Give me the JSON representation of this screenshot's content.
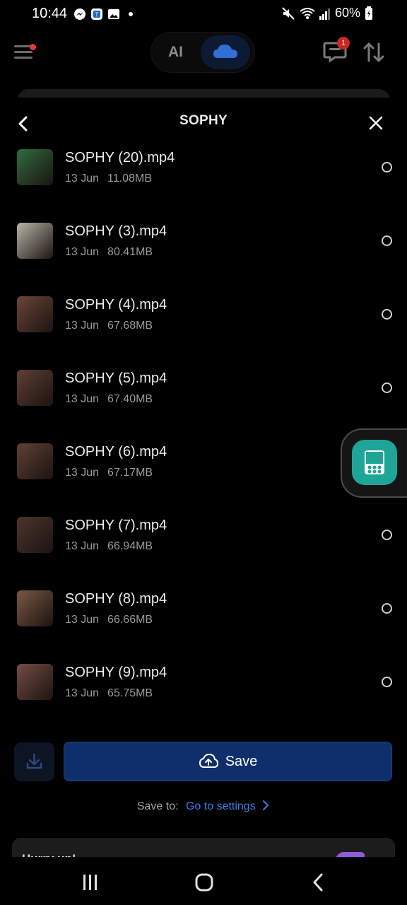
{
  "status_bar": {
    "time": "10:44",
    "battery": "60%",
    "app_icons": [
      "messenger-icon",
      "teams-icon",
      "gallery-icon",
      "dot-icon"
    ],
    "right_icons": [
      "mute-icon",
      "wifi-icon",
      "signal-icon",
      "battery-icon"
    ]
  },
  "app_bar": {
    "toggle_ai_label": "AI",
    "message_badge": "1"
  },
  "sheet": {
    "title": "SOPHY",
    "files": [
      {
        "name": "SOPHY (20).mp4",
        "date": "13 Jun",
        "size": "11.08MB",
        "thumb": "#2f6b3e"
      },
      {
        "name": "SOPHY (3).mp4",
        "date": "13 Jun",
        "size": "80.41MB",
        "thumb": "#b7b4a8"
      },
      {
        "name": "SOPHY (4).mp4",
        "date": "13 Jun",
        "size": "67.68MB",
        "thumb": "#6a4538"
      },
      {
        "name": "SOPHY (5).mp4",
        "date": "13 Jun",
        "size": "67.40MB",
        "thumb": "#5e3f34"
      },
      {
        "name": "SOPHY (6).mp4",
        "date": "13 Jun",
        "size": "67.17MB",
        "thumb": "#614034"
      },
      {
        "name": "SOPHY (7).mp4",
        "date": "13 Jun",
        "size": "66.94MB",
        "thumb": "#4c352e"
      },
      {
        "name": "SOPHY (8).mp4",
        "date": "13 Jun",
        "size": "66.66MB",
        "thumb": "#7a5844"
      },
      {
        "name": "SOPHY (9).mp4",
        "date": "13 Jun",
        "size": "65.75MB",
        "thumb": "#734d43"
      }
    ]
  },
  "actions": {
    "save_label": "Save",
    "save_to_label": "Save to:",
    "save_to_link": "Go to settings"
  },
  "promo": {
    "text": "Hurry up!"
  },
  "colors": {
    "accent": "#0e2f6b",
    "link": "#3d7ee8",
    "floating_button": "#1fa597",
    "badge": "#c62828"
  }
}
